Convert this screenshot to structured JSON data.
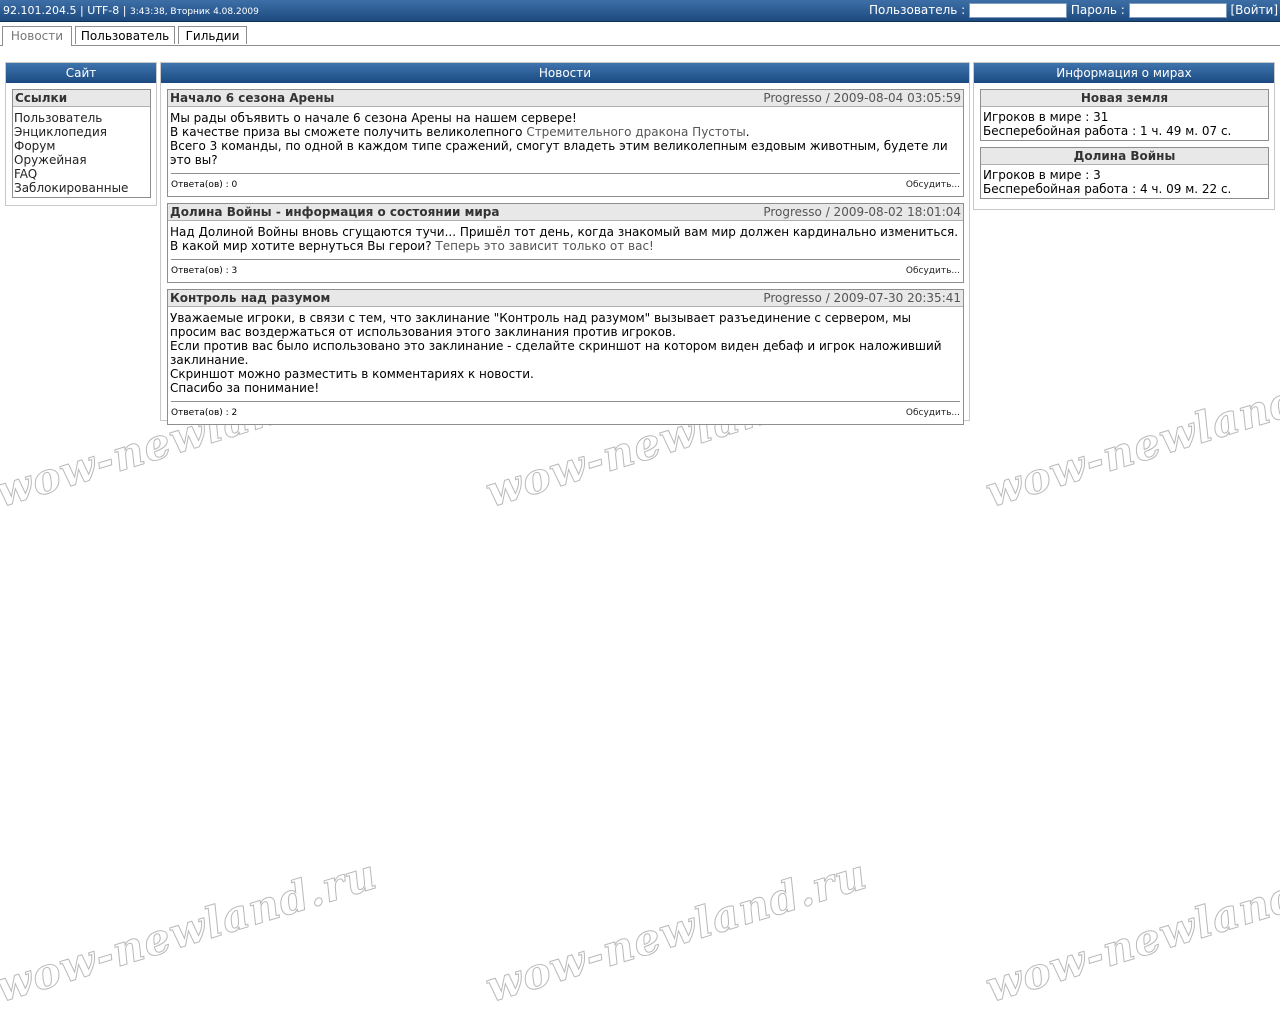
{
  "topbar": {
    "ip": "92.101.204.5",
    "encoding": "UTF-8",
    "sep": "|",
    "datetime": "3:43:38, Вторник 4.08.2009",
    "user_label": "Пользователь :",
    "pass_label": "Пароль :",
    "login_label": "[Войти]"
  },
  "tabs": [
    "Новости",
    "Пользователь",
    "Гильдии"
  ],
  "site_panel": {
    "title": "Сайт",
    "links_title": "Ссылки",
    "links": [
      "Пользователь",
      "Энциклопедия",
      "Форум",
      "Оружейная",
      "FAQ",
      "Заблокированные"
    ]
  },
  "news_panel": {
    "title": "Новости",
    "items": [
      {
        "title": "Начало 6 сезона Арены",
        "meta": "Progresso / 2009-08-04 03:05:59",
        "line1": "Мы рады объявить о начале 6 сезона Арены на нашем сервере!",
        "line2a": "В качестве приза вы сможете получить великолепного ",
        "line2b": "Стремительного дракона Пустоты",
        "line2c": ".",
        "line3": "Всего 3 команды, по одной в каждом типе сражений, смогут владеть этим великолепным ездовым животным, будете ли это вы?",
        "replies": "Ответа(ов) : 0",
        "discuss": "Обсудить..."
      },
      {
        "title": "Долина Войны - информация о состоянии мира",
        "meta": "Progresso / 2009-08-02 18:01:04",
        "line1": "Над Долиной Войны вновь сгущаются тучи... Пришёл тот день, когда знакомый вам мир должен кардинально измениться. В какой мир хотите вернуться Вы герои? ",
        "line1b": "Теперь это зависит только от вас!",
        "replies": "Ответа(ов) : 3",
        "discuss": "Обсудить..."
      },
      {
        "title": "Контроль над разумом",
        "meta": "Progresso / 2009-07-30 20:35:41",
        "line1": "Уважаемые игроки, в связи с тем, что заклинание \"Контроль над разумом\" вызывает разъединение с сервером, мы просим вас воздержаться от использования этого заклинания против игроков.",
        "line2": "Если против вас было использовано это заклинание - сделайте скриншот на котором виден дебаф и игрок наложивший заклинание.",
        "line3": "Скриншот можно разместить в комментариях к новости.",
        "line4": "Спасибо за понимание!",
        "replies": "Ответа(ов) : 2",
        "discuss": "Обсудить..."
      }
    ]
  },
  "worlds_panel": {
    "title": "Информация о мирах",
    "worlds": [
      {
        "name": "Новая земля",
        "players": "Игроков в мире : 31",
        "uptime": "Бесперебойная работа : 1 ч. 49 м. 07 с."
      },
      {
        "name": "Долина Войны",
        "players": "Игроков в мире : 3",
        "uptime": "Бесперебойная работа : 4 ч. 09 м. 22 с."
      }
    ]
  },
  "watermark": "wow-newland.ru"
}
